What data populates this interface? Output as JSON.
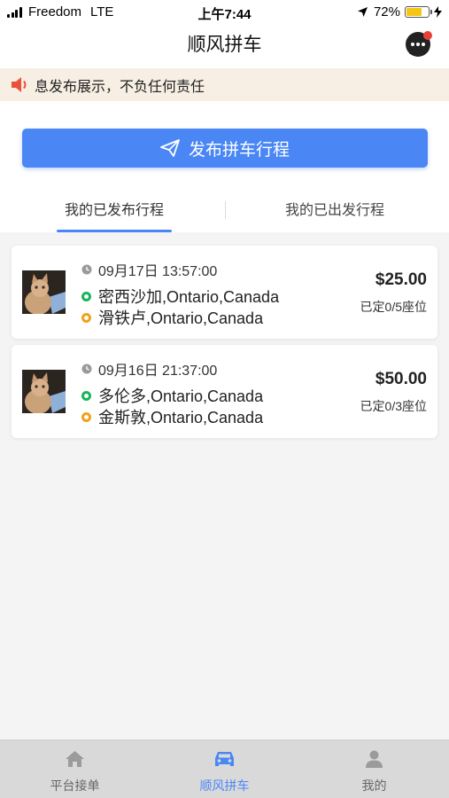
{
  "status_bar": {
    "carrier": "Freedom",
    "network": "LTE",
    "time": "上午7:44",
    "battery": "72%",
    "battery_level": 0.72
  },
  "header": {
    "title": "顺风拼车"
  },
  "notice": {
    "text": "息发布展示，不负任何责任"
  },
  "publish_button": {
    "label": "发布拼车行程"
  },
  "tabs": [
    {
      "label": "我的已发布行程",
      "active": true
    },
    {
      "label": "我的已出发行程",
      "active": false
    }
  ],
  "trips": [
    {
      "datetime": "09月17日 13:57:00",
      "from": "密西沙加,Ontario,Canada",
      "to": "滑铁卢,Ontario,Canada",
      "price": "$25.00",
      "seats": "已定0/5座位"
    },
    {
      "datetime": "09月16日 21:37:00",
      "from": "多伦多,Ontario,Canada",
      "to": "金斯敦,Ontario,Canada",
      "price": "$50.00",
      "seats": "已定0/3座位"
    }
  ],
  "tab_bar": [
    {
      "label": "平台接单",
      "icon": "home-icon",
      "active": false
    },
    {
      "label": "顺风拼车",
      "icon": "car-icon",
      "active": true
    },
    {
      "label": "我的",
      "icon": "person-icon",
      "active": false
    }
  ],
  "colors": {
    "accent": "#4a87f5",
    "notice_bg": "#f7efe3",
    "from_dot": "#19b45c",
    "to_dot": "#f0a21a",
    "chat_badge": "#e8413a"
  }
}
